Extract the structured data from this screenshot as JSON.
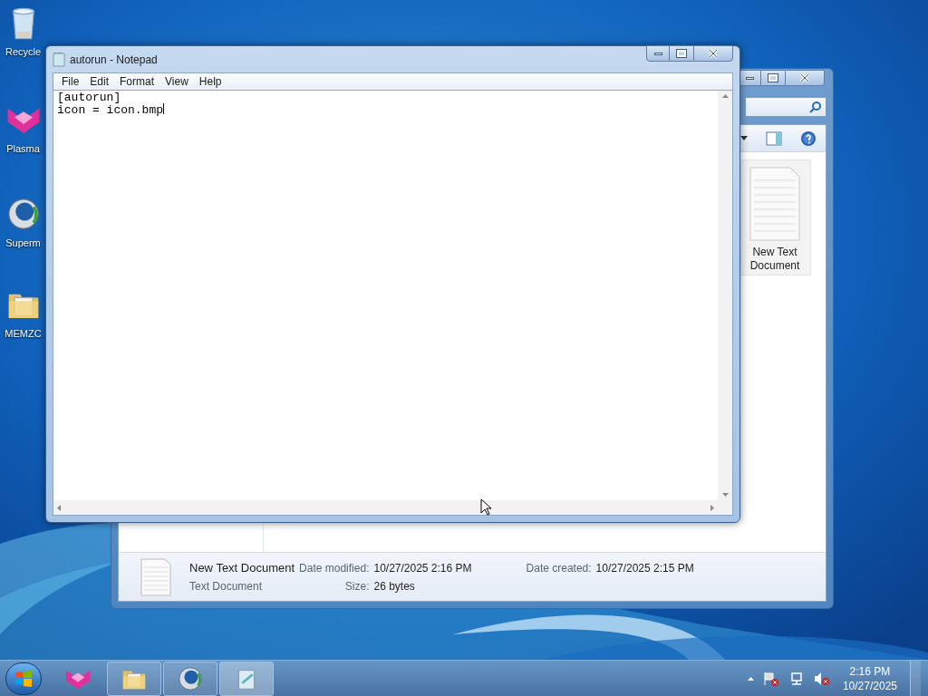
{
  "desktop_icons": [
    {
      "label": "Recycle",
      "kind": "bin"
    },
    {
      "label": "Plasma",
      "kind": "plasma"
    },
    {
      "label": "Superm",
      "kind": "globe"
    },
    {
      "label": "MEMZC",
      "kind": "folder"
    }
  ],
  "explorer": {
    "file": {
      "label": "New Text Document"
    },
    "details": {
      "name": "New Text Document",
      "type": "Text Document",
      "modified_label": "Date modified:",
      "modified": "10/27/2025 2:16 PM",
      "created_label": "Date created:",
      "created": "10/27/2025 2:15 PM",
      "size_label": "Size:",
      "size": "26 bytes"
    }
  },
  "notepad": {
    "title": "autorun - Notepad",
    "menu": [
      "File",
      "Edit",
      "Format",
      "View",
      "Help"
    ],
    "lines": [
      "[autorun]",
      "icon = icon.bmp"
    ]
  },
  "taskbar": {
    "items": [
      {
        "kind": "plasma",
        "running": false,
        "selected": false
      },
      {
        "kind": "folder",
        "running": true,
        "selected": false
      },
      {
        "kind": "globe",
        "running": true,
        "selected": false
      },
      {
        "kind": "notepad",
        "running": true,
        "selected": true
      }
    ],
    "time": "2:16 PM",
    "date": "10/27/2025"
  }
}
